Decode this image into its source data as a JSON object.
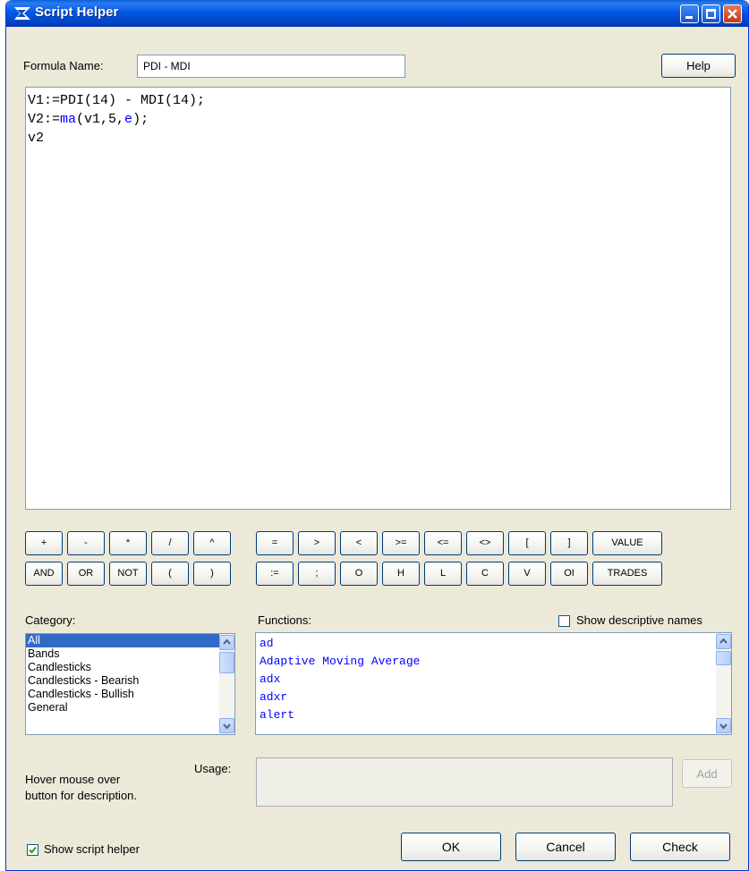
{
  "window": {
    "title": "Script Helper"
  },
  "formula": {
    "label": "Formula Name:",
    "value": "PDI - MDI"
  },
  "help_button": "Help",
  "editor": {
    "lines": [
      {
        "parts": [
          {
            "t": "V1:=PDI(14) - MDI(14);",
            "kw": false
          }
        ]
      },
      {
        "parts": [
          {
            "t": "V2:=",
            "kw": false
          },
          {
            "t": "ma",
            "kw": true
          },
          {
            "t": "(v1,5,",
            "kw": false
          },
          {
            "t": "e",
            "kw": true
          },
          {
            "t": ");",
            "kw": false
          }
        ]
      },
      {
        "parts": [
          {
            "t": "v2",
            "kw": false
          }
        ]
      }
    ]
  },
  "operators": {
    "row1": [
      "+",
      "-",
      "*",
      "/",
      "^"
    ],
    "row2": [
      "AND",
      "OR",
      "NOT",
      "(",
      ")"
    ],
    "row3": [
      "=",
      ">",
      "<",
      ">=",
      "<=",
      "<>",
      "[",
      "]",
      "VALUE"
    ],
    "row4": [
      ":=",
      ";",
      "O",
      "H",
      "L",
      "C",
      "V",
      "OI",
      "TRADES"
    ]
  },
  "category": {
    "label": "Category:",
    "items": [
      "All",
      "Bands",
      "Candlesticks",
      "Candlesticks - Bearish",
      "Candlesticks - Bullish",
      "General"
    ],
    "selected": "All"
  },
  "functions": {
    "label": "Functions:",
    "show_descriptive_label": "Show descriptive names",
    "show_descriptive_checked": false,
    "items": [
      "ad",
      "Adaptive Moving Average",
      "adx",
      "adxr",
      "alert"
    ]
  },
  "hint": {
    "line1": "Hover mouse over",
    "line2": "button for description."
  },
  "usage": {
    "label": "Usage:",
    "value": ""
  },
  "add_button": "Add",
  "footer": {
    "show_script_helper_label": "Show script helper",
    "show_script_helper_checked": true,
    "ok": "OK",
    "cancel": "Cancel",
    "check": "Check"
  },
  "colors": {
    "titlebar": "#0058e6",
    "dialog_bg": "#ece9d8",
    "selection": "#316ac5",
    "function_text": "#0000ff"
  }
}
